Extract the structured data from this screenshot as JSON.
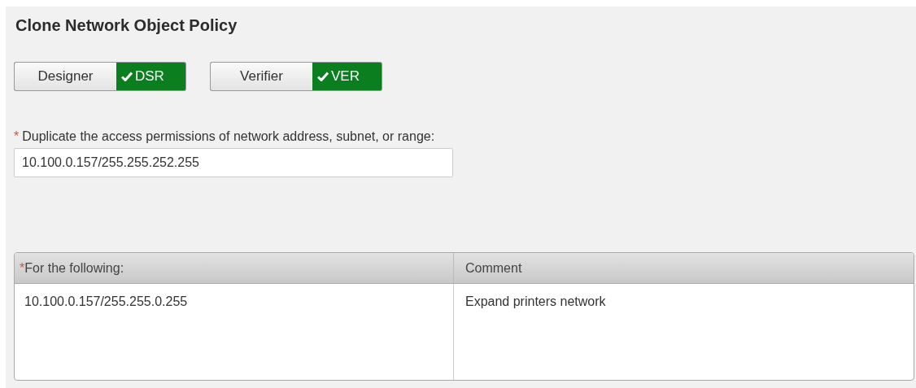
{
  "title": "Clone Network Object Policy",
  "roles": [
    {
      "label": "Designer",
      "code": "DSR",
      "approved": true
    },
    {
      "label": "Verifier",
      "code": "VER",
      "approved": true
    }
  ],
  "source_field": {
    "required_mark": "*",
    "label": "Duplicate the access permissions of network address, subnet, or range:",
    "value": "10.100.0.157/255.255.252.255"
  },
  "table": {
    "columns": [
      {
        "label": "For the following:",
        "required_mark": "*"
      },
      {
        "label": "Comment"
      }
    ],
    "rows": [
      [
        "10.100.0.157/255.255.0.255",
        "Expand printers network"
      ]
    ]
  }
}
